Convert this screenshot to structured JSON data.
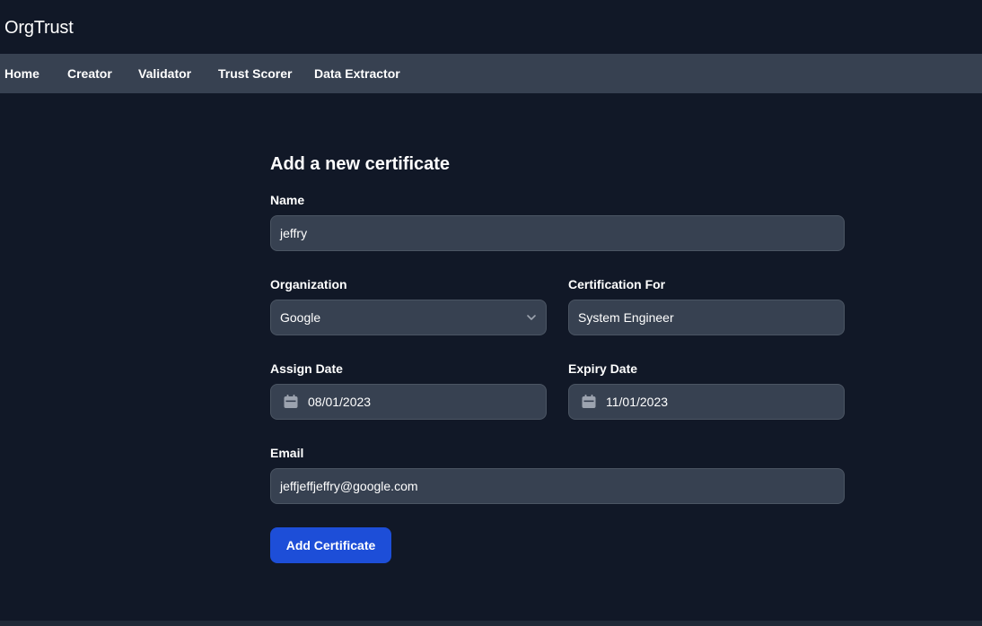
{
  "app": {
    "brand": "OrgTrust"
  },
  "nav": {
    "items": [
      {
        "label": "Home"
      },
      {
        "label": "Creator"
      },
      {
        "label": "Validator"
      },
      {
        "label": "Trust Scorer"
      },
      {
        "label": "Data Extractor"
      }
    ]
  },
  "form": {
    "title": "Add a new certificate",
    "name": {
      "label": "Name",
      "value": "jeffry"
    },
    "organization": {
      "label": "Organization",
      "value": "Google",
      "icon": "chevron-down-icon"
    },
    "certification_for": {
      "label": "Certification For",
      "value": "System Engineer"
    },
    "assign_date": {
      "label": "Assign Date",
      "value": "08/01/2023",
      "icon": "calendar-icon"
    },
    "expiry_date": {
      "label": "Expiry Date",
      "value": "11/01/2023",
      "icon": "calendar-icon"
    },
    "email": {
      "label": "Email",
      "value": "jeffjeffjeffry@google.com"
    },
    "submit_label": "Add Certificate"
  },
  "colors": {
    "background": "#111827",
    "nav_background": "#374151",
    "input_background": "#374151",
    "input_border": "#4b5563",
    "button": "#1d4ed8",
    "icon": "#9ca3af"
  }
}
